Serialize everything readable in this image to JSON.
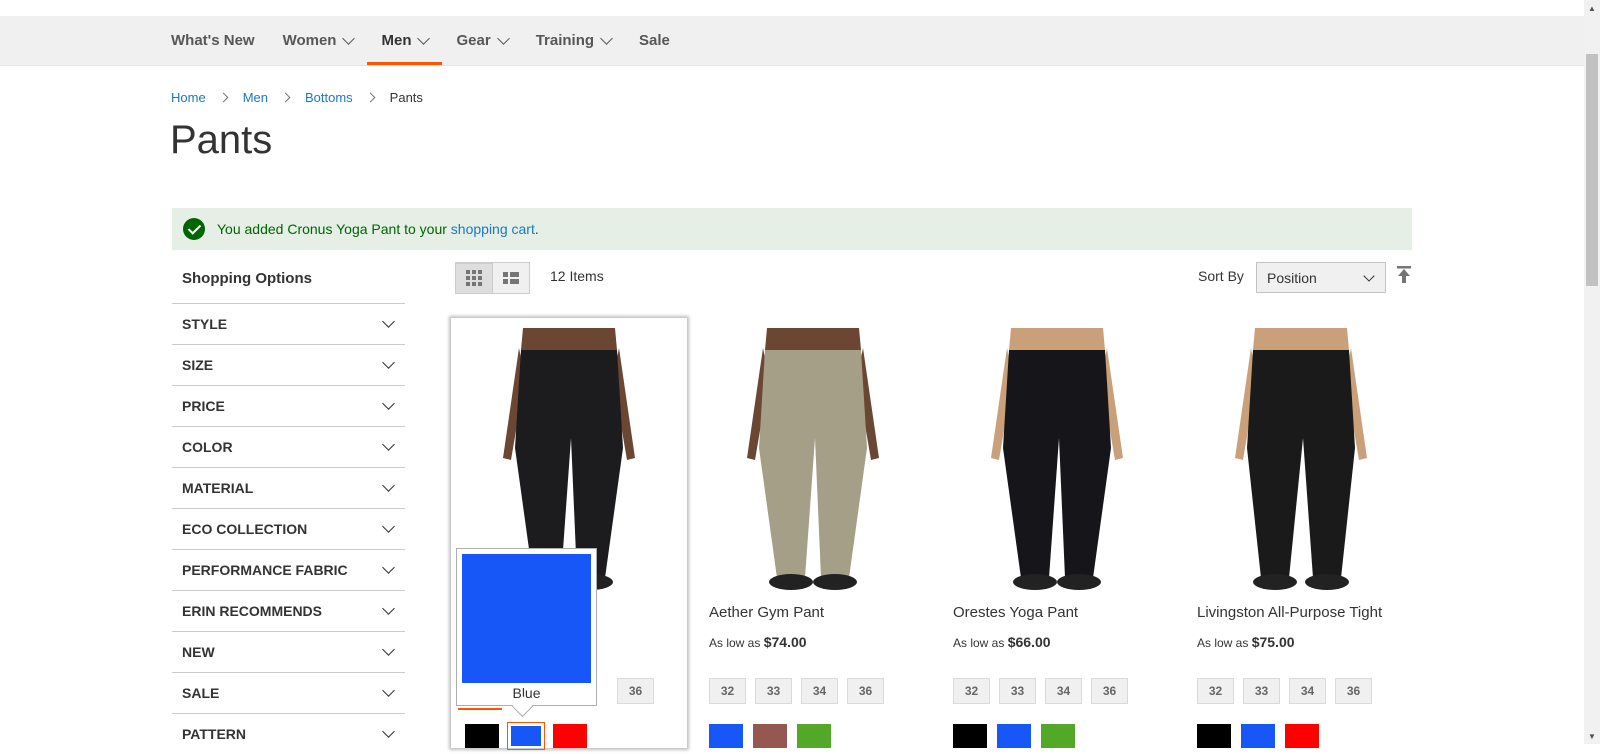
{
  "nav": {
    "items": [
      {
        "label": "What's New",
        "dropdown": false,
        "active": false
      },
      {
        "label": "Women",
        "dropdown": true,
        "active": false
      },
      {
        "label": "Men",
        "dropdown": true,
        "active": true
      },
      {
        "label": "Gear",
        "dropdown": true,
        "active": false
      },
      {
        "label": "Training",
        "dropdown": true,
        "active": false
      },
      {
        "label": "Sale",
        "dropdown": false,
        "active": false
      }
    ]
  },
  "breadcrumb": {
    "home": "Home",
    "men": "Men",
    "bottoms": "Bottoms",
    "current": "Pants"
  },
  "page_title": "Pants",
  "message": {
    "prefix": "You added Cronus Yoga Pant to your ",
    "link": "shopping cart",
    "suffix": "."
  },
  "sidebar": {
    "title": "Shopping Options",
    "filters": [
      "STYLE",
      "SIZE",
      "PRICE",
      "COLOR",
      "MATERIAL",
      "ECO COLLECTION",
      "PERFORMANCE FABRIC",
      "ERIN RECOMMENDS",
      "NEW",
      "SALE",
      "PATTERN"
    ]
  },
  "toolbar": {
    "items_count": "12 Items",
    "sort_label": "Sort By",
    "sort_value": "Position"
  },
  "tooltip": {
    "label": "Blue",
    "color": "#1857f7"
  },
  "products": [
    {
      "name": "",
      "price_prefix": "",
      "price": "",
      "sizes": [
        "36"
      ],
      "colors": [
        "#000000",
        "#1857f7",
        "#ff0000"
      ],
      "pants": "#1c1c1e",
      "skin": "#6b4632",
      "hovered": true
    },
    {
      "name": "Aether Gym Pant",
      "price_prefix": "As low as",
      "price": "$74.00",
      "sizes": [
        "32",
        "33",
        "34",
        "36"
      ],
      "colors": [
        "#1857f7",
        "#945850",
        "#53a828"
      ],
      "pants": "#a69f88",
      "skin": "#6b4632",
      "hovered": false
    },
    {
      "name": "Orestes Yoga Pant",
      "price_prefix": "As low as",
      "price": "$66.00",
      "sizes": [
        "32",
        "33",
        "34",
        "36"
      ],
      "colors": [
        "#000000",
        "#1857f7",
        "#53a828"
      ],
      "pants": "#16161a",
      "skin": "#caa07a",
      "hovered": false
    },
    {
      "name": "Livingston All-Purpose Tight",
      "price_prefix": "As low as",
      "price": "$75.00",
      "sizes": [
        "32",
        "33",
        "34",
        "36"
      ],
      "colors": [
        "#000000",
        "#1857f7",
        "#ff0000"
      ],
      "pants": "#1a1a1a",
      "skin": "#caa07a",
      "hovered": false
    }
  ]
}
